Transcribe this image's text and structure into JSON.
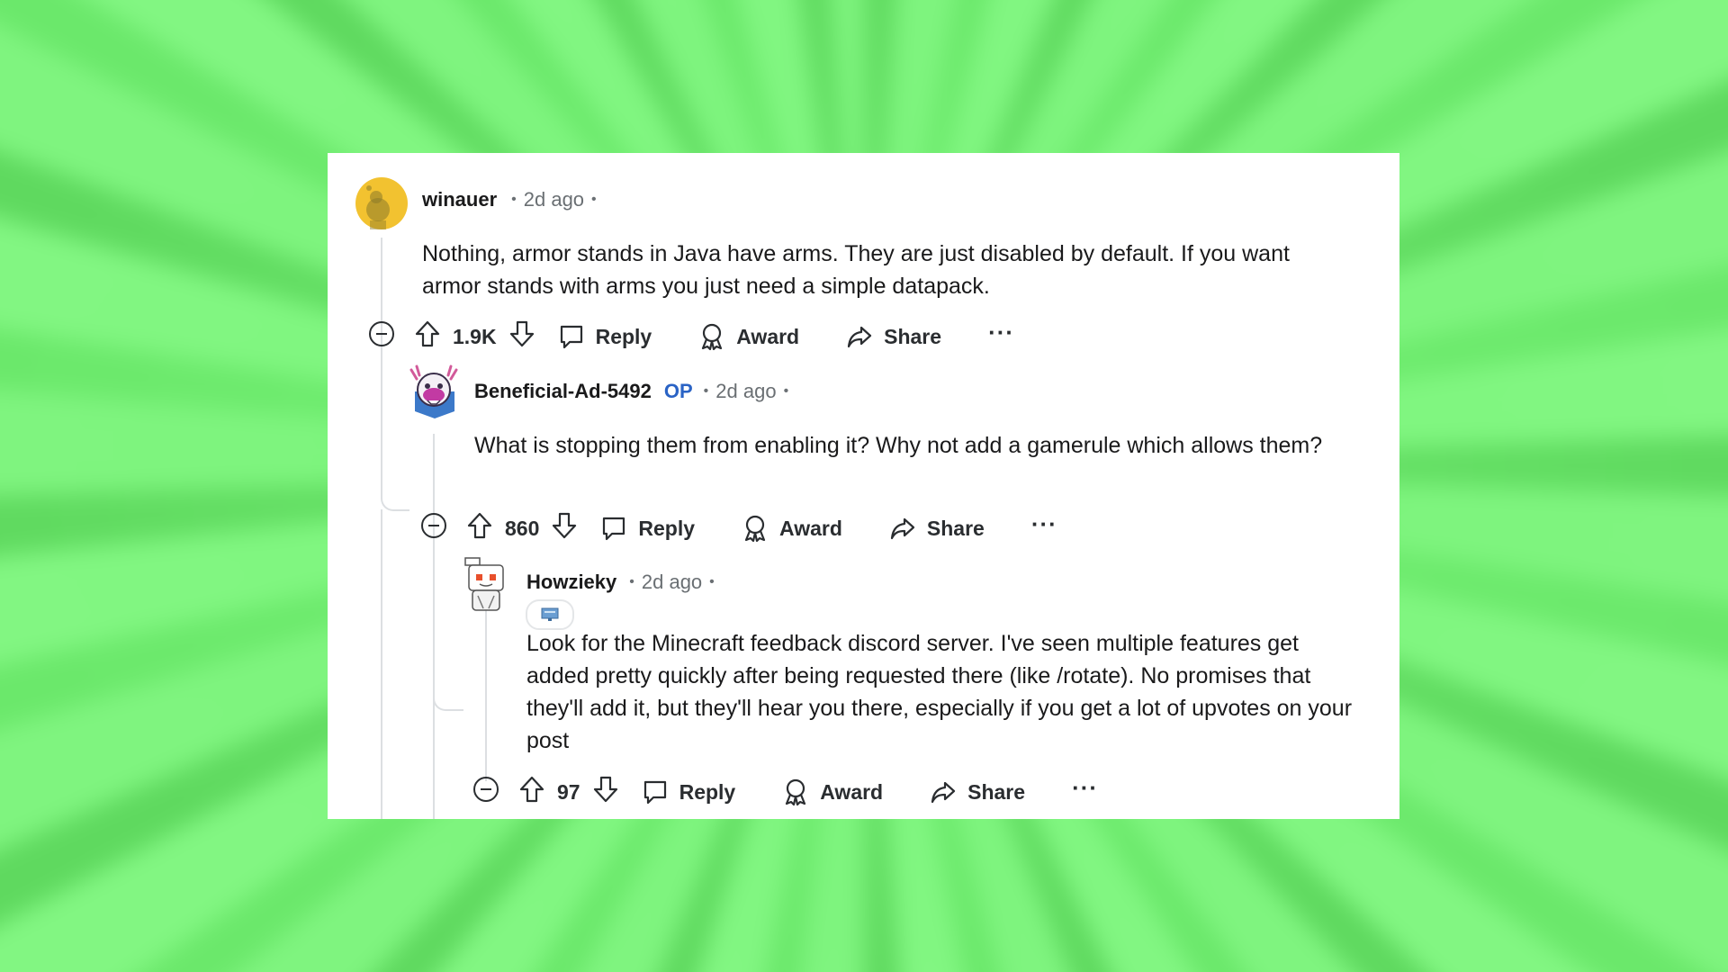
{
  "comments": [
    {
      "username": "winauer",
      "time": "2d ago",
      "body": "Nothing, armor stands in Java have arms. They are just disabled by default. If you want armor stands with arms you just need a simple datapack.",
      "votes": "1.9K"
    },
    {
      "username": "Beneficial-Ad-5492",
      "op_badge": "OP",
      "time": "2d ago",
      "body": "What is stopping them from enabling it? Why not add a gamerule which allows them?",
      "votes": "860"
    },
    {
      "username": "Howzieky",
      "time": "2d ago",
      "body": "Look for the Minecraft feedback discord server. I've seen multiple features get added pretty quickly after being requested there (like /rotate). No promises that they'll add it, but they'll hear you there, especially if you get a lot of upvotes on your post",
      "votes": "97"
    }
  ],
  "labels": {
    "reply": "Reply",
    "award": "Award",
    "share": "Share",
    "more": "···",
    "dot": "•"
  },
  "colors": {
    "background_green": "#74f276",
    "op_blue": "#2a63c5",
    "avatar_yellow": "#f2c230",
    "thread_line": "#dcdfe2"
  }
}
